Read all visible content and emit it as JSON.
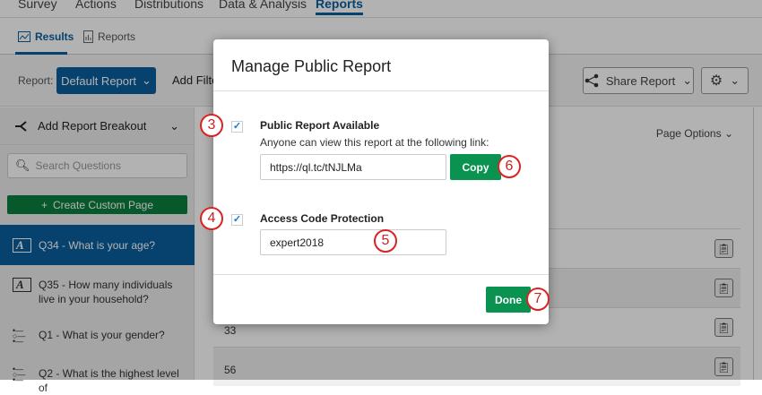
{
  "top_nav": {
    "items": [
      "Survey",
      "Actions",
      "Distributions",
      "Data & Analysis",
      "Reports"
    ],
    "active": "Reports"
  },
  "sub_nav": {
    "results": "Results",
    "reports": "Reports"
  },
  "toolbar": {
    "report_label": "Report:",
    "report_value": "Default Report",
    "add_filter": "Add Filter",
    "share_report": "Share Report"
  },
  "sidebar": {
    "breakout": "Add Report Breakout",
    "search_placeholder": "Search Questions",
    "create_page": "Create Custom Page",
    "questions": [
      {
        "label": "Q34 - What is your age?",
        "type": "text-entry",
        "selected": true
      },
      {
        "label": "Q35 - How many individuals live in your household?",
        "type": "text-entry"
      },
      {
        "label": "Q1 - What is your gender?",
        "type": "multiple-choice"
      },
      {
        "label": "Q2 - What is the highest level of",
        "type": "multiple-choice"
      }
    ]
  },
  "main": {
    "page_options": "Page Options",
    "rows": [
      "",
      "",
      "33",
      "56"
    ]
  },
  "modal": {
    "title": "Manage Public Report",
    "public_label": "Public Report Available",
    "public_checked": true,
    "public_desc": "Anyone can view this report at the following link:",
    "link": "https://ql.tc/tNJLMa",
    "copy": "Copy",
    "access_label": "Access Code Protection",
    "access_checked": true,
    "access_code": "expert2018",
    "done": "Done"
  },
  "callouts": [
    "3",
    "4",
    "5",
    "6",
    "7"
  ],
  "colors": {
    "primary": "#0b5fa0",
    "green": "#0a9250",
    "callout": "#d22222"
  }
}
